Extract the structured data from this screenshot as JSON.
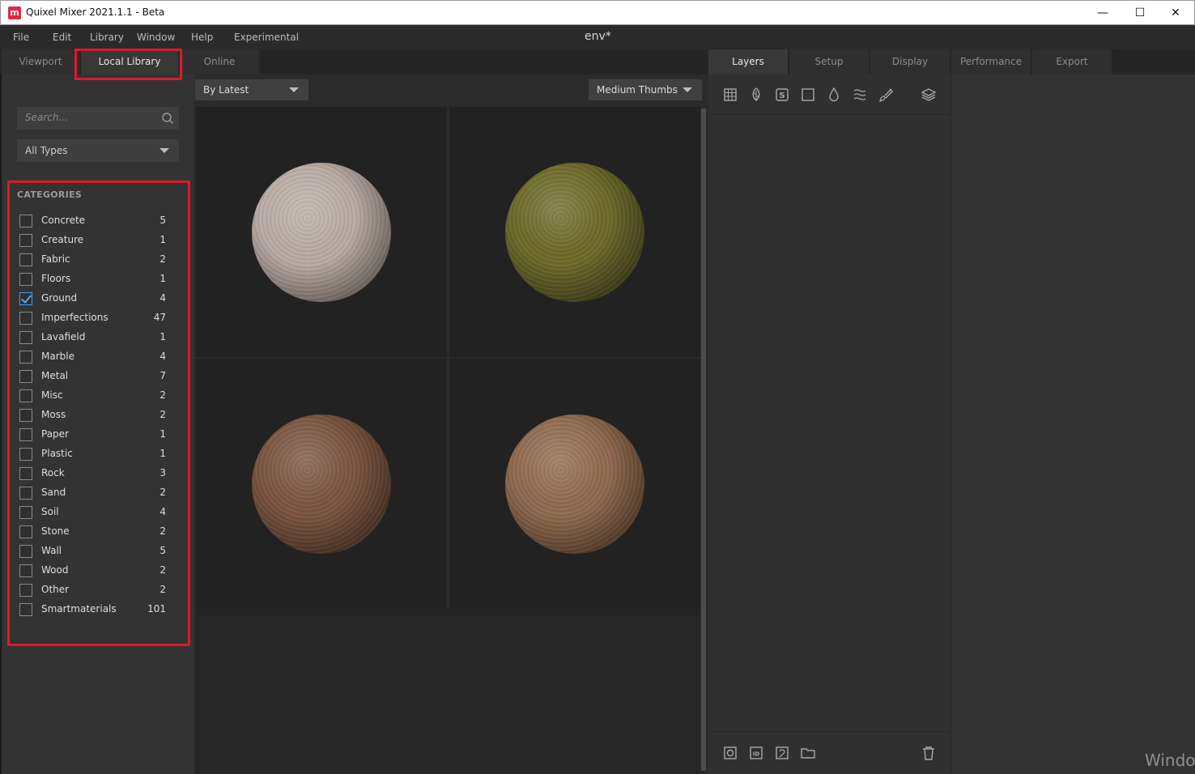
{
  "window": {
    "title": "Quixel Mixer 2021.1.1 - Beta",
    "minimize": "—",
    "maximize": "☐",
    "close": "✕"
  },
  "menu": {
    "items": [
      "File",
      "Edit",
      "Library",
      "Window",
      "Help",
      "Experimental"
    ],
    "document_title": "env*"
  },
  "left_tabs": [
    {
      "label": "Viewport",
      "active": false
    },
    {
      "label": "Local Library",
      "active": true
    },
    {
      "label": "Online",
      "active": false
    }
  ],
  "right_tabs": [
    {
      "label": "Layers",
      "active": true
    },
    {
      "label": "Setup",
      "active": false
    },
    {
      "label": "Display",
      "active": false
    },
    {
      "label": "Performance",
      "active": false
    },
    {
      "label": "Export",
      "active": false
    }
  ],
  "search": {
    "placeholder": "Search...",
    "value": ""
  },
  "type_filter": {
    "selected": "All Types"
  },
  "sort": {
    "selected": "By Latest"
  },
  "thumb_size": {
    "selected": "Medium Thumbs"
  },
  "categories": {
    "header": "CATEGORIES",
    "items": [
      {
        "label": "Concrete",
        "count": "5",
        "checked": false
      },
      {
        "label": "Creature",
        "count": "1",
        "checked": false
      },
      {
        "label": "Fabric",
        "count": "2",
        "checked": false
      },
      {
        "label": "Floors",
        "count": "1",
        "checked": false
      },
      {
        "label": "Ground",
        "count": "4",
        "checked": true
      },
      {
        "label": "Imperfections",
        "count": "47",
        "checked": false
      },
      {
        "label": "Lavafield",
        "count": "1",
        "checked": false
      },
      {
        "label": "Marble",
        "count": "4",
        "checked": false
      },
      {
        "label": "Metal",
        "count": "7",
        "checked": false
      },
      {
        "label": "Misc",
        "count": "2",
        "checked": false
      },
      {
        "label": "Moss",
        "count": "2",
        "checked": false
      },
      {
        "label": "Paper",
        "count": "1",
        "checked": false
      },
      {
        "label": "Plastic",
        "count": "1",
        "checked": false
      },
      {
        "label": "Rock",
        "count": "3",
        "checked": false
      },
      {
        "label": "Sand",
        "count": "2",
        "checked": false
      },
      {
        "label": "Soil",
        "count": "4",
        "checked": false
      },
      {
        "label": "Stone",
        "count": "2",
        "checked": false
      },
      {
        "label": "Wall",
        "count": "5",
        "checked": false
      },
      {
        "label": "Wood",
        "count": "2",
        "checked": false
      },
      {
        "label": "Other",
        "count": "2",
        "checked": false
      },
      {
        "label": "Smartmaterials",
        "count": "101",
        "checked": false
      }
    ]
  },
  "materials": [
    {
      "name": "gravel-sphere",
      "base": "#b8aca4",
      "dark": "#3a302c"
    },
    {
      "name": "mossy-ground-sphere",
      "base": "#6d6a2a",
      "dark": "#1d1c0c"
    },
    {
      "name": "soil-sphere",
      "base": "#7a5540",
      "dark": "#241610"
    },
    {
      "name": "cracked-mud-sphere",
      "base": "#8f6a4e",
      "dark": "#2a1c12"
    }
  ],
  "layer_toolbar_icons": [
    "grid-icon",
    "leaf-icon",
    "smart-material-icon",
    "square-icon",
    "drop-icon",
    "water-icon",
    "brush-icon",
    "layers-stack-icon"
  ],
  "layer_bottom_icons": [
    "mask-icon",
    "id-map-icon",
    "custom-icon",
    "folder-icon",
    "trash-icon"
  ],
  "watermark": "Windo",
  "colors": {
    "accent": "#4aa8ff",
    "highlight": "#e0182a",
    "brand": "#e0294a"
  }
}
